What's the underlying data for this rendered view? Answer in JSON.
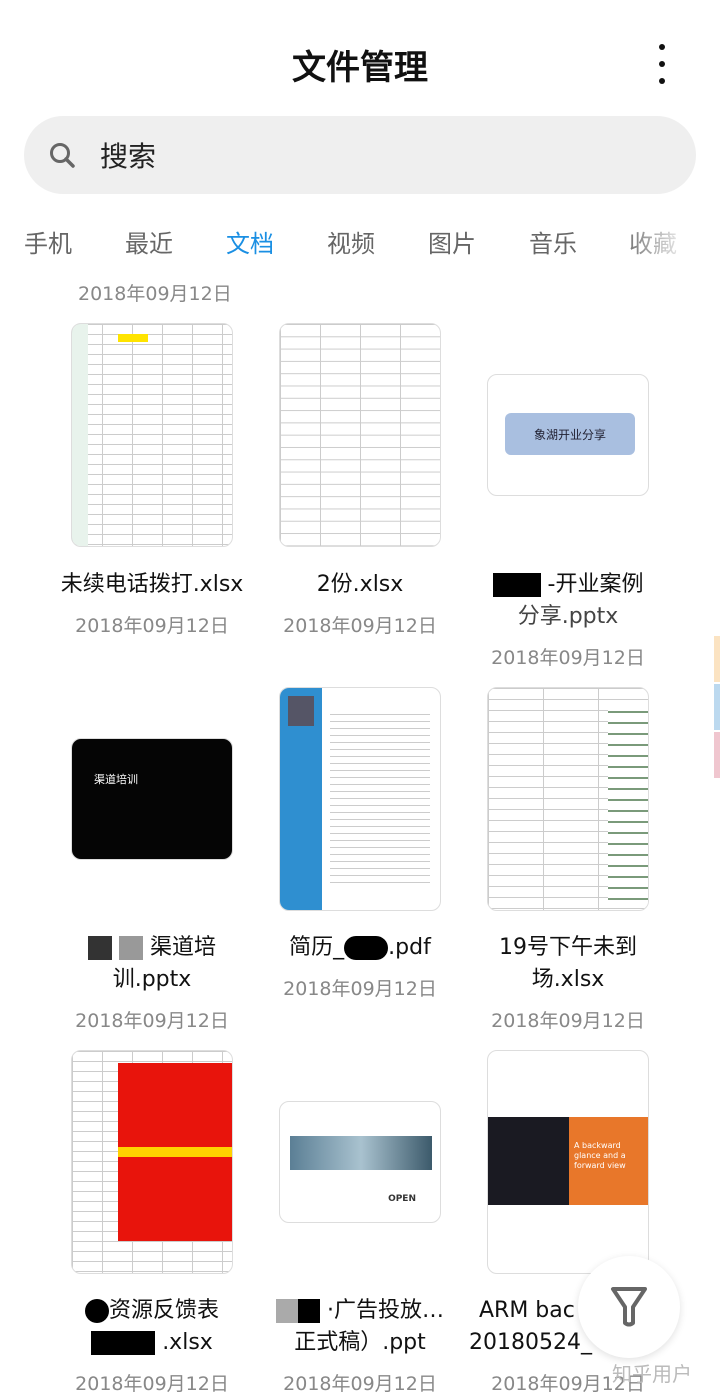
{
  "header": {
    "title": "文件管理",
    "more_icon": "more-vertical-icon"
  },
  "search": {
    "placeholder": "搜索",
    "icon": "search-icon"
  },
  "tabs": [
    {
      "label": "手机"
    },
    {
      "label": "最近"
    },
    {
      "label": "文档",
      "active": true
    },
    {
      "label": "视频"
    },
    {
      "label": "图片"
    },
    {
      "label": "音乐"
    },
    {
      "label": "收藏"
    }
  ],
  "accent": "#1a8fe3",
  "top_date": "2018年09月12日",
  "files": [
    {
      "name1": "未续电话拨打.xlsx",
      "name2": "",
      "date": "2018年09月12日",
      "type": "xlsx"
    },
    {
      "name1": "2份.xlsx",
      "name2": "",
      "date": "2018年09月12日",
      "type": "xlsx"
    },
    {
      "name1": "-开业案例",
      "name2": "分享.pptx",
      "date": "2018年09月12日",
      "type": "pptx",
      "thumb_text": "象湖开业分享"
    },
    {
      "name1": "渠道培",
      "name2": "训.pptx",
      "date": "2018年09月12日",
      "type": "pptx",
      "thumb_text": "渠道培训"
    },
    {
      "name1": "简历_",
      "name2": ".pdf",
      "date": "2018年09月12日",
      "type": "pdf"
    },
    {
      "name1": "19号下午未到",
      "name2": "场.xlsx",
      "date": "2018年09月12日",
      "type": "xlsx"
    },
    {
      "name1": "资源反馈表",
      "name2": ".xlsx",
      "date": "2018年09月12日",
      "type": "xlsx"
    },
    {
      "name1": "·广告投放…",
      "name2": "正式稿）.ppt",
      "date": "2018年09月12日",
      "type": "ppt",
      "thumb_text": "OPEN"
    },
    {
      "name1": "ARM bac",
      "name2": "20180524_",
      "date": "2018年09月12日",
      "type": "pdf",
      "thumb_text": "A backward glance and a forward view"
    }
  ],
  "fab": {
    "icon": "filter-icon"
  },
  "watermark": "知乎用户"
}
